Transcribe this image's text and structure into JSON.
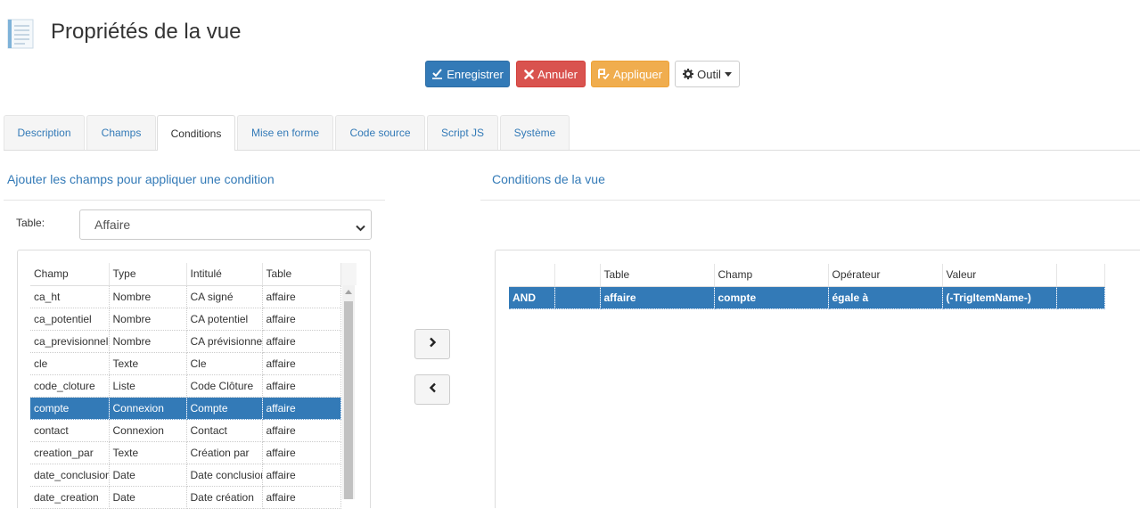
{
  "header": {
    "title": "Propriétés de la vue",
    "icon": "document-icon"
  },
  "toolbar": {
    "save_label": "Enregistrer",
    "cancel_label": "Annuler",
    "apply_label": "Appliquer",
    "tool_label": "Outil",
    "colors": {
      "save": "#337ab7",
      "cancel": "#d9534f",
      "apply": "#f0ad4e"
    }
  },
  "tabs": [
    {
      "label": "Description"
    },
    {
      "label": "Champs"
    },
    {
      "label": "Conditions",
      "active": true
    },
    {
      "label": "Mise en forme"
    },
    {
      "label": "Code source"
    },
    {
      "label": "Script JS"
    },
    {
      "label": "Système"
    }
  ],
  "left": {
    "heading": "Ajouter les champs pour appliquer une condition",
    "table_label": "Table:",
    "table_value": "Affaire",
    "columns": [
      "Champ",
      "Type",
      "Intitulé",
      "Table"
    ],
    "rows": [
      [
        "ca_ht",
        "Nombre",
        "CA signé",
        "affaire"
      ],
      [
        "ca_potentiel",
        "Nombre",
        "CA potentiel",
        "affaire"
      ],
      [
        "ca_previsionnel",
        "Nombre",
        "CA prévisionnel",
        "affaire"
      ],
      [
        "cle",
        "Texte",
        "Cle",
        "affaire"
      ],
      [
        "code_cloture",
        "Liste",
        "Code Clôture",
        "affaire"
      ],
      [
        "compte",
        "Connexion",
        "Compte",
        "affaire"
      ],
      [
        "contact",
        "Connexion",
        "Contact",
        "affaire"
      ],
      [
        "creation_par",
        "Texte",
        "Création par",
        "affaire"
      ],
      [
        "date_conclusion",
        "Date",
        "Date conclusion",
        "affaire"
      ],
      [
        "date_creation",
        "Date",
        "Date création",
        "affaire"
      ]
    ],
    "selected_row": 5
  },
  "right": {
    "heading": "Conditions de la vue",
    "columns": [
      "",
      "",
      "Table",
      "Champ",
      "Opérateur",
      "Valeur",
      ""
    ],
    "rows": [
      [
        "AND",
        "",
        "affaire",
        "compte",
        "égale à",
        "(-TrigItemName-)",
        ""
      ]
    ],
    "selected_row": 0
  }
}
